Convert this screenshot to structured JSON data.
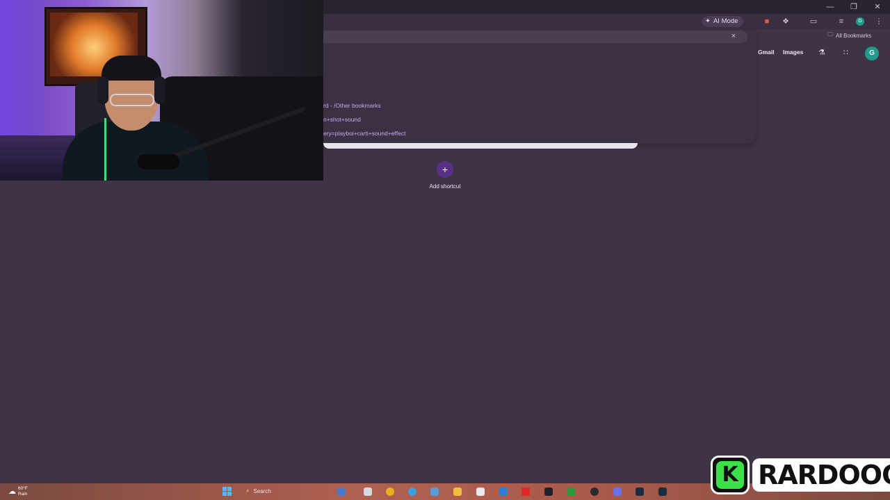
{
  "browser": {
    "ai_mode_label": "AI Mode",
    "bookmarks_label": "All Bookmarks",
    "profile_initial": "G",
    "close_icon": "×"
  },
  "suggestions": [
    "rd - /Other bookmarks",
    "n+shot+sound",
    "ery=playboi+carti+sound+effect"
  ],
  "ntp": {
    "gmail": "Gmail",
    "images": "Images",
    "profile_initial": "G",
    "add_shortcut_label": "Add shortcut",
    "add_icon": "+"
  },
  "taskbar": {
    "weather_temp": "60°F",
    "weather_cond": "Rain",
    "search_label": "Search"
  },
  "overlay": {
    "logo_letter": "K",
    "logo_text": "RARDOOO"
  },
  "colors": {
    "background": "#3f3446",
    "accent": "#5a2f86",
    "suggestion_text": "#c9a7f0",
    "logo_green": "#3ee04a"
  }
}
